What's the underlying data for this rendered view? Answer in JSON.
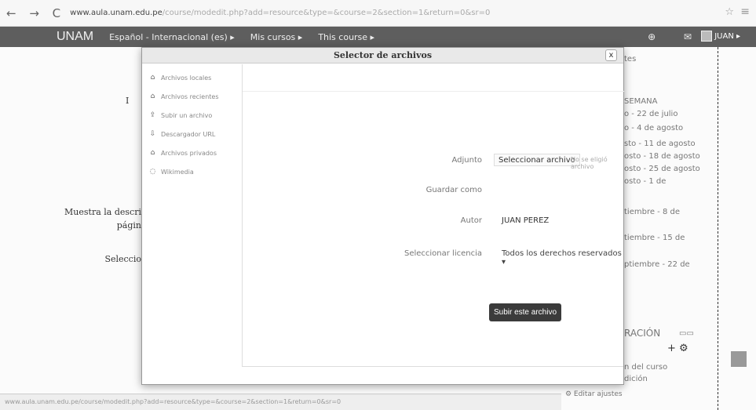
{
  "browser": {
    "back_forward": "← → C",
    "url_host": "www.aula.unam.edu.pe",
    "url_path": "/course/modedit.php?add=resource&type=&course=2&section=1&return=0&sr=0",
    "star": "☆",
    "menu": "≡"
  },
  "navbar": {
    "brand": "UNAM",
    "language": "Español - Internacional (es) ▸",
    "my_courses": "Mis cursos ▸",
    "this_course": "This course ▸",
    "icons": "⊕ ✉",
    "user": "JUAN ▸"
  },
  "left_labels": {
    "partial_top": "I",
    "show_desc_1": "Muestra la descri",
    "show_desc_2": "págin",
    "select": "Seleccio"
  },
  "right_sidebar": {
    "item0": "tes",
    "item1": "SEMANA",
    "item2": "o - 22 de julio",
    "item3": "o - 4 de agosto",
    "item4": "sto - 11 de agosto",
    "item5": "osto - 18 de agosto",
    "item6": "osto - 25 de agosto",
    "item7": "osto - 1 de",
    "item8": "tiembre - 8 de",
    "item9": "tiembre - 15 de",
    "item10": "ptiembre - 22 de",
    "admin": "RACIÓN",
    "admin_icons": "▭▭",
    "add_icon": "+ ⚙",
    "course_line": "n del curso",
    "edition_line": "dición",
    "edit_settings": "⚙ Editar ajustes"
  },
  "status_bar": "www.aula.unam.edu.pe/course/modedit.php?add=resource&type=&course=2&section=1&return=0&sr=0",
  "file_picker": {
    "title": "Selector de archivos",
    "close": "x",
    "sidebar": [
      {
        "icon": "folder-icon",
        "glyph": "⌂",
        "label": "Archivos locales"
      },
      {
        "icon": "folder-icon",
        "glyph": "⌂",
        "label": "Archivos recientes"
      },
      {
        "icon": "upload-icon",
        "glyph": "⇪",
        "label": "Subir un archivo"
      },
      {
        "icon": "download-icon",
        "glyph": "⇩",
        "label": "Descargador URL"
      },
      {
        "icon": "folder-icon",
        "glyph": "⌂",
        "label": "Archivos privados"
      },
      {
        "icon": "wikimedia-icon",
        "glyph": "◌",
        "label": "Wikimedia"
      }
    ],
    "form": {
      "attachment_label": "Adjunto",
      "attachment_button": "Seleccionar archivo",
      "attachment_status": "No se eligió archivo",
      "save_as_label": "Guardar como",
      "author_label": "Autor",
      "author_value": "JUAN PEREZ",
      "license_label": "Seleccionar licencia",
      "license_value": "Todos los derechos reservados",
      "license_arrow": "▾",
      "upload_button": "Subir este archivo"
    }
  }
}
